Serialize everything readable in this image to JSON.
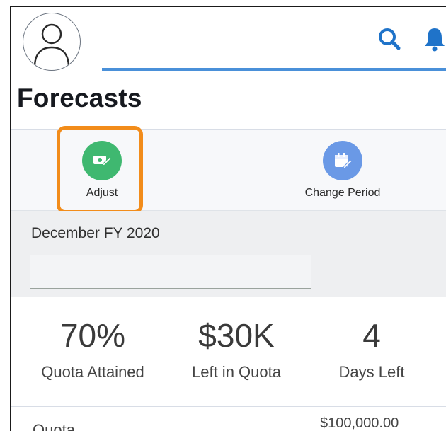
{
  "header": {
    "avatar_icon": "user-avatar-icon",
    "search_icon": "search-icon",
    "notification_icon": "bell-icon",
    "accent_color": "#4a90d9"
  },
  "page": {
    "title": "Forecasts"
  },
  "actions": [
    {
      "label": "Adjust",
      "icon": "adjust-money-icon",
      "color": "#3fb870",
      "highlighted": true
    },
    {
      "label": "Change Period",
      "icon": "calendar-edit-icon",
      "color": "#6a99e6",
      "highlighted": false
    }
  ],
  "highlight_color": "#f28c1a",
  "period": {
    "label": "December FY 2020",
    "value": ""
  },
  "stats": [
    {
      "value": "70%",
      "caption": "Quota Attained"
    },
    {
      "value": "$30K",
      "caption": "Left in Quota"
    },
    {
      "value": "4",
      "caption": "Days Left"
    }
  ],
  "quota": {
    "label": "Quota",
    "value": "$100,000.00"
  }
}
